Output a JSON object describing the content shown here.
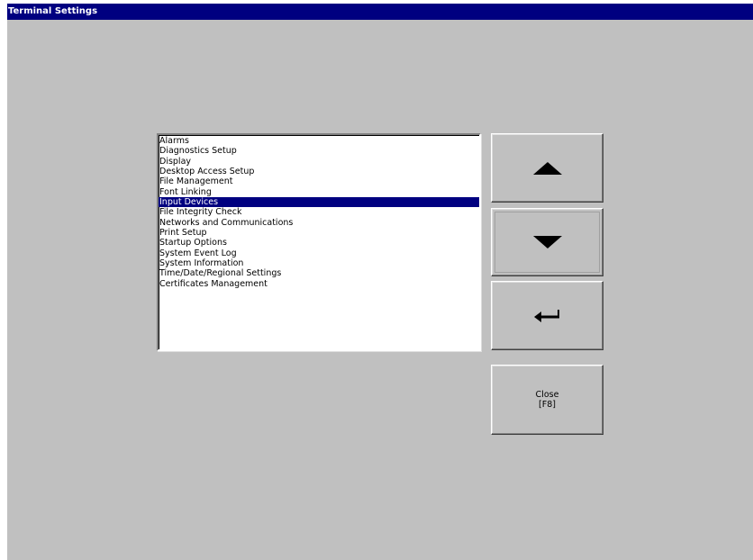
{
  "window": {
    "title": "Terminal Settings"
  },
  "settings_list": {
    "selected_index": 6,
    "items": [
      "Alarms",
      "Diagnostics Setup",
      "Display",
      "Desktop Access Setup",
      "File Management",
      "Font Linking",
      "Input Devices",
      "File Integrity Check",
      "Networks and Communications",
      "Print Setup",
      "Startup Options",
      "System Event Log",
      "System Information",
      "Time/Date/Regional Settings",
      "Certificates Management"
    ]
  },
  "buttons": {
    "up_icon": "arrow-up-icon",
    "down_icon": "arrow-down-icon",
    "enter_icon": "enter-return-icon",
    "close_label": "Close",
    "close_key": "[F8]"
  },
  "colors": {
    "background": "#c0c0c0",
    "title_bar": "#000080",
    "selection": "#000080",
    "list_background": "#ffffff"
  }
}
